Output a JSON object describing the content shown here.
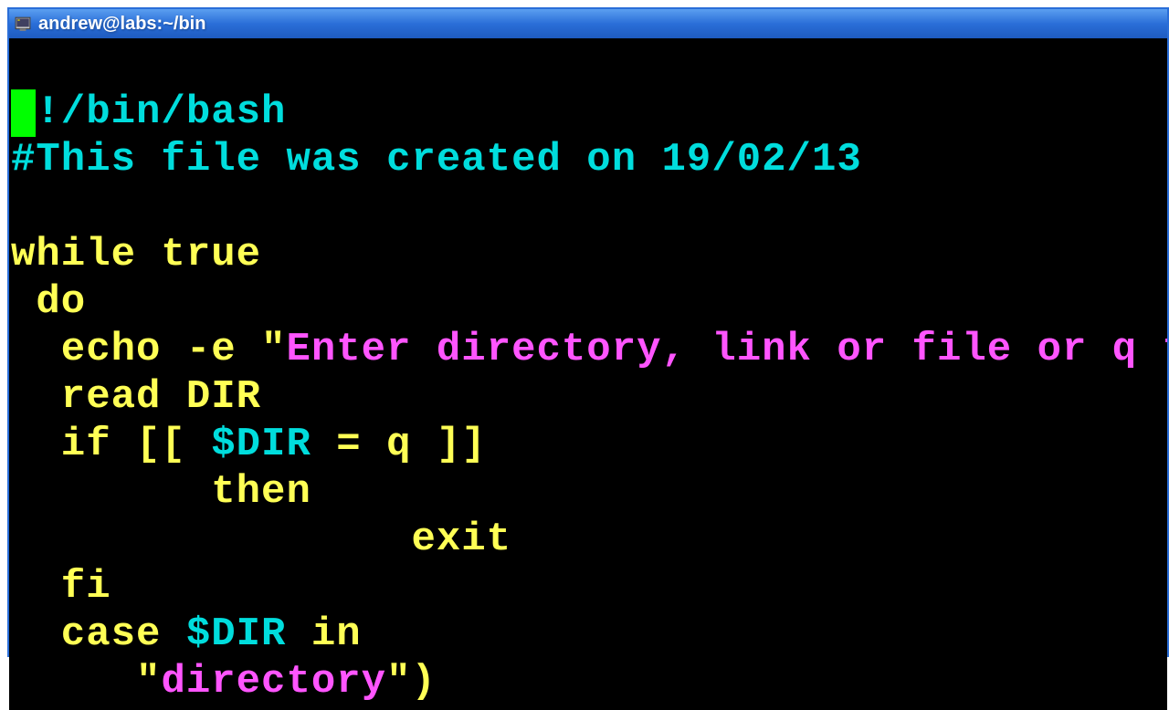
{
  "window": {
    "title": "andrew@labs:~/bin"
  },
  "code": {
    "line1_cursor": "#",
    "line1_shebang": "!/bin/bash",
    "line2_comment": "#This file was created on 19/02/13",
    "line3_empty": "",
    "line4_while": "while",
    "line4_true": " true",
    "line5_do": " do",
    "line6_echo": "  echo -e ",
    "line6_quote": "\"",
    "line6_string": "Enter directory, link or file or q t",
    "line7_read": "  read DIR",
    "line8_if": "  if",
    "line8_bracket1": " [[ ",
    "line8_var": "$DIR",
    "line8_eq": " = q ]]",
    "line9_then": "        then",
    "line10_exit": "                exit",
    "line11_fi": "  fi",
    "line12_case": "  case",
    "line12_space": " ",
    "line12_var": "$DIR",
    "line12_in": " in",
    "line13_space": "     ",
    "line13_quote": "\"",
    "line13_string": "directory",
    "line13_quote2": "\"",
    "line13_paren": ")"
  }
}
